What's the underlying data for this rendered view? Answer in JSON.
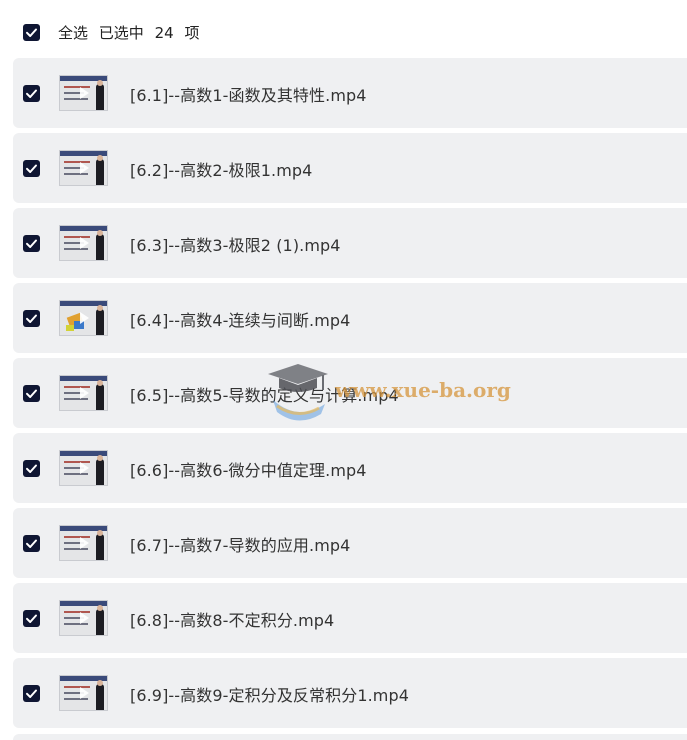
{
  "header": {
    "select_all": "全选",
    "selected_prefix": "已选中",
    "selected_count": "24",
    "selected_suffix": "项",
    "checked": true
  },
  "files": [
    {
      "name": "[6.1]--高数1-函数及其特性.mp4",
      "checked": true
    },
    {
      "name": "[6.2]--高数2-极限1.mp4",
      "checked": true
    },
    {
      "name": "[6.3]--高数3-极限2 (1).mp4",
      "checked": true
    },
    {
      "name": "[6.4]--高数4-连续与间断.mp4",
      "checked": true
    },
    {
      "name": "[6.5]--高数5-导数的定义与计算.mp4",
      "checked": true
    },
    {
      "name": "[6.6]--高数6-微分中值定理.mp4",
      "checked": true
    },
    {
      "name": "[6.7]--高数7-导数的应用.mp4",
      "checked": true
    },
    {
      "name": "[6.8]--高数8-不定积分.mp4",
      "checked": true
    },
    {
      "name": "[6.9]--高数9-定积分及反常积分1.mp4",
      "checked": true
    }
  ],
  "watermark": {
    "text": "www.xue-ba.org",
    "icon": "graduation-cap-icon"
  },
  "colors": {
    "checkbox": "#0f1633",
    "row_background": "#eff0f2",
    "watermark": "#d6963c"
  }
}
